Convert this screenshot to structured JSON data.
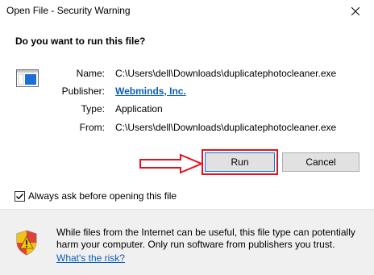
{
  "window": {
    "title": "Open File - Security Warning"
  },
  "prompt": {
    "question": "Do you want to run this file?"
  },
  "details": {
    "name_label": "Name:",
    "name_value": "C:\\Users\\dell\\Downloads\\duplicatephotocleaner.exe",
    "publisher_label": "Publisher:",
    "publisher_value": "Webminds, Inc.",
    "type_label": "Type:",
    "type_value": "Application",
    "from_label": "From:",
    "from_value": "C:\\Users\\dell\\Downloads\\duplicatephotocleaner.exe"
  },
  "buttons": {
    "run_label": "Run",
    "cancel_label": "Cancel"
  },
  "options": {
    "always_ask_label": "Always ask before opening this file",
    "always_ask_checked": true
  },
  "footer": {
    "warning_text": "While files from the Internet can be useful, this file type can potentially harm your computer. Only run software from publishers you trust.",
    "risk_link": "What's the risk?"
  },
  "colors": {
    "highlight": "#e8101e",
    "link": "#0b5eb8",
    "footer_bg": "#f0f0f0"
  },
  "icons": {
    "close": "close-icon",
    "app": "application-icon",
    "shield": "security-shield-icon",
    "arrow": "annotation-arrow"
  }
}
